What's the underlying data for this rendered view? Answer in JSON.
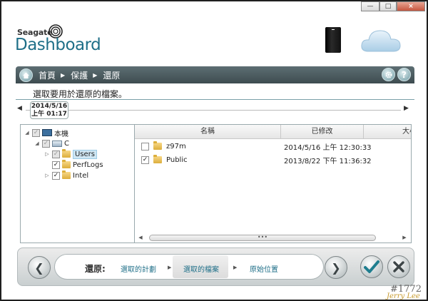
{
  "window": {
    "min_label": "—",
    "max_label": "□",
    "close_label": "×"
  },
  "brand": {
    "company": "Seagate",
    "app_name": "Dashboard"
  },
  "nav": {
    "breadcrumbs": [
      "首頁",
      "保護",
      "還原"
    ],
    "settings_icon": "gear-icon",
    "help_label": "?"
  },
  "instruction": "選取要用於還原的檔案。",
  "timeline": {
    "date": "2014/5/16",
    "time": "上午 01:17",
    "left_arrow": "◀",
    "right_arrow": "▶"
  },
  "tree": {
    "items": [
      {
        "label": "本機",
        "expander": "◢",
        "checkbox": "partial",
        "icon": "computer-icon"
      },
      {
        "label": "C",
        "expander": "◢",
        "checkbox": "partial",
        "icon": "drive-icon"
      },
      {
        "label": "Users",
        "expander": "▷",
        "checkbox": "partial",
        "icon": "folder-icon",
        "selected": true
      },
      {
        "label": "PerfLogs",
        "expander": "",
        "checkbox": "checked",
        "icon": "folder-icon"
      },
      {
        "label": "Intel",
        "expander": "▷",
        "checkbox": "checked",
        "icon": "folder-icon"
      }
    ]
  },
  "files": {
    "columns": [
      "名稱",
      "已修改",
      "大小"
    ],
    "rows": [
      {
        "name": "z97m",
        "modified": "2014/5/16 上午 12:30:33",
        "checked": false
      },
      {
        "name": "Public",
        "modified": "2013/8/22 下午 11:36:32",
        "checked": true
      }
    ],
    "scroll_thumb": "•••"
  },
  "wizard": {
    "label": "還原:",
    "steps": [
      "選取的計劃",
      "選取的檔案",
      "原始位置"
    ],
    "active_step": 1,
    "back_label": "❮",
    "next_label": "❯"
  },
  "watermark": {
    "number": "#1772",
    "name": "Jerry Lee"
  },
  "colors": {
    "brand_teal": "#1f6f88",
    "nav_bar": "#4a5a5e"
  }
}
